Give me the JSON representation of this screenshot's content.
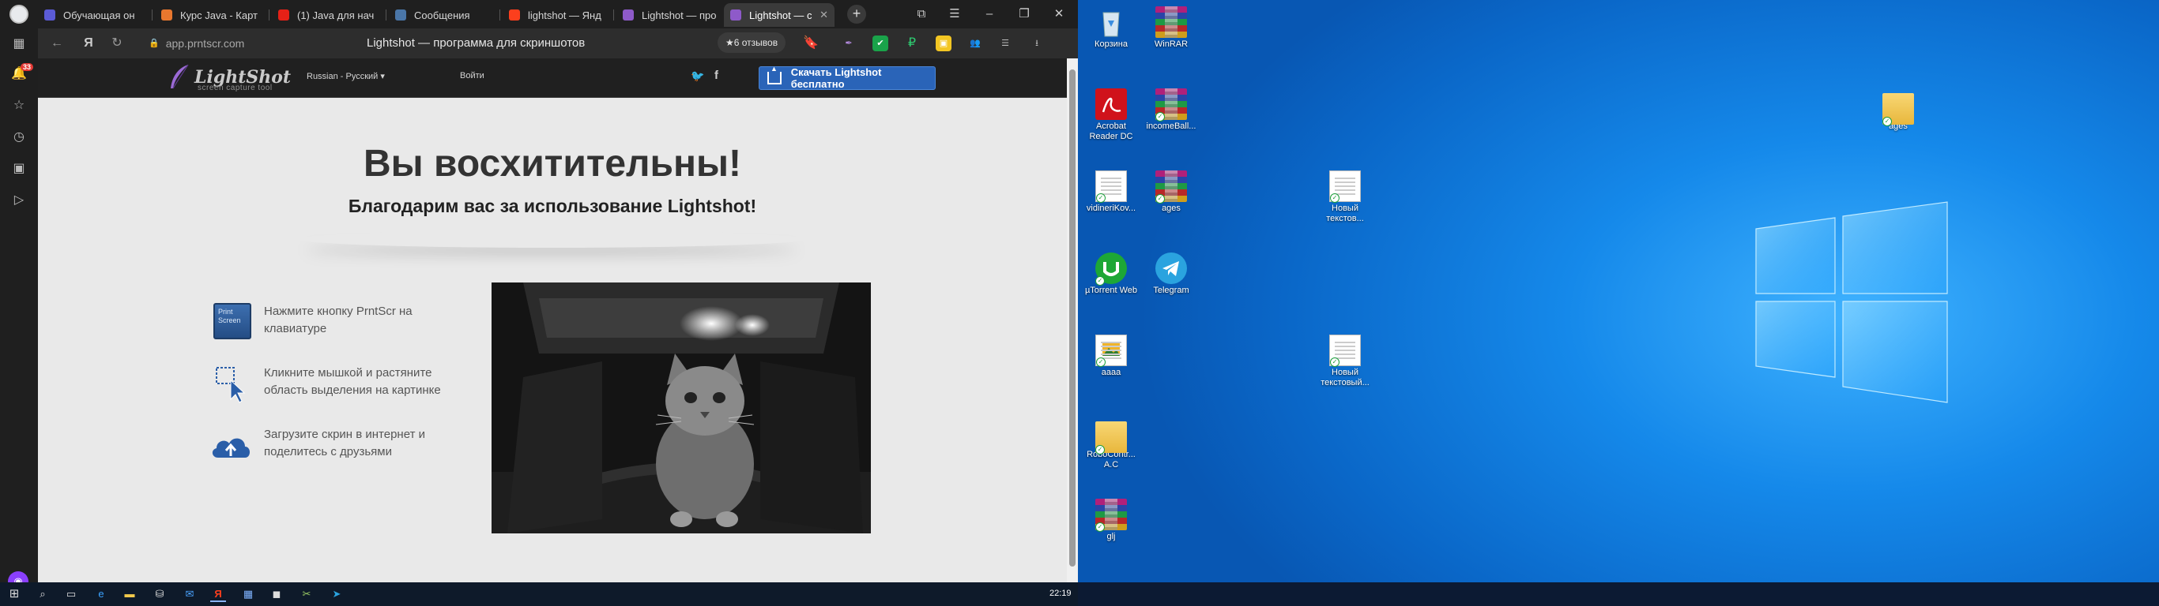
{
  "browser": {
    "tabs": [
      {
        "label": "Обучающая он",
        "favicon_color": "#5b5bd6"
      },
      {
        "label": "Курс Java - Карт",
        "favicon_color": "#e8772e"
      },
      {
        "label": "(1) Java для нач",
        "favicon_color": "#e62117"
      },
      {
        "label": "Сообщения",
        "favicon_color": "#4a76a8"
      },
      {
        "label": "lightshot — Янд",
        "favicon_color": "#fc3f1d"
      },
      {
        "label": "Lightshot — про",
        "favicon_color": "#8e5ac9"
      },
      {
        "label": "Lightshot — с",
        "favicon_color": "#8e5ac9"
      }
    ],
    "active_tab_index": 6,
    "new_tab_label": "+",
    "url": "app.prntscr.com",
    "page_title": "Lightshot — программа для скриншотов",
    "reviews_label": "★6 отзывов",
    "sidebar_badge": "33",
    "profile_color": "#e8eaed",
    "accent_color": "#2a64b8"
  },
  "lightshot": {
    "logo": "LightShot",
    "tagline": "screen capture tool",
    "language": "Russian - Русский ▾",
    "login": "Войти",
    "twitter_glyph": "🐦",
    "facebook_glyph": "f",
    "download_button": "Скачать Lightshot бесплатно",
    "hero_title": "Вы восхитительны!",
    "hero_subtitle": "Благодарим вас за использование Lightshot!",
    "prtscr_key": "Print Screen",
    "steps": [
      {
        "icon": "print-screen-key-icon",
        "text": "Нажмите кнопку PrntScr на клавиатуре"
      },
      {
        "icon": "selection-cursor-icon",
        "text": "Кликните мышкой и растяните область выделения на картинке"
      },
      {
        "icon": "cloud-upload-icon",
        "text": "Загрузите скрин в интернет и поделитесь с друзьями"
      }
    ]
  },
  "desktop": {
    "icons": [
      {
        "label": "Корзина",
        "type": "recycle-bin"
      },
      {
        "label": "WinRAR",
        "type": "winrar"
      },
      {
        "label": "Acrobat Reader DC",
        "type": "acrobat"
      },
      {
        "label": "incomeBall...",
        "type": "winrar"
      },
      {
        "label": "vidineriKov...",
        "type": "document"
      },
      {
        "label": "ages",
        "type": "winrar"
      },
      {
        "label": "µTorrent Web",
        "type": "utorrent"
      },
      {
        "label": "Telegram",
        "type": "telegram"
      },
      {
        "label": "aaaa",
        "type": "image"
      },
      {
        "label": "RoboContr... A.C",
        "type": "folder"
      },
      {
        "label": "glj",
        "type": "winrar"
      },
      {
        "label": "Новый текстов...",
        "type": "document"
      },
      {
        "label": "Новый текстовый...",
        "type": "document"
      },
      {
        "label": "ages",
        "type": "folder"
      }
    ]
  },
  "taskbar": {
    "clock": "22:19"
  }
}
